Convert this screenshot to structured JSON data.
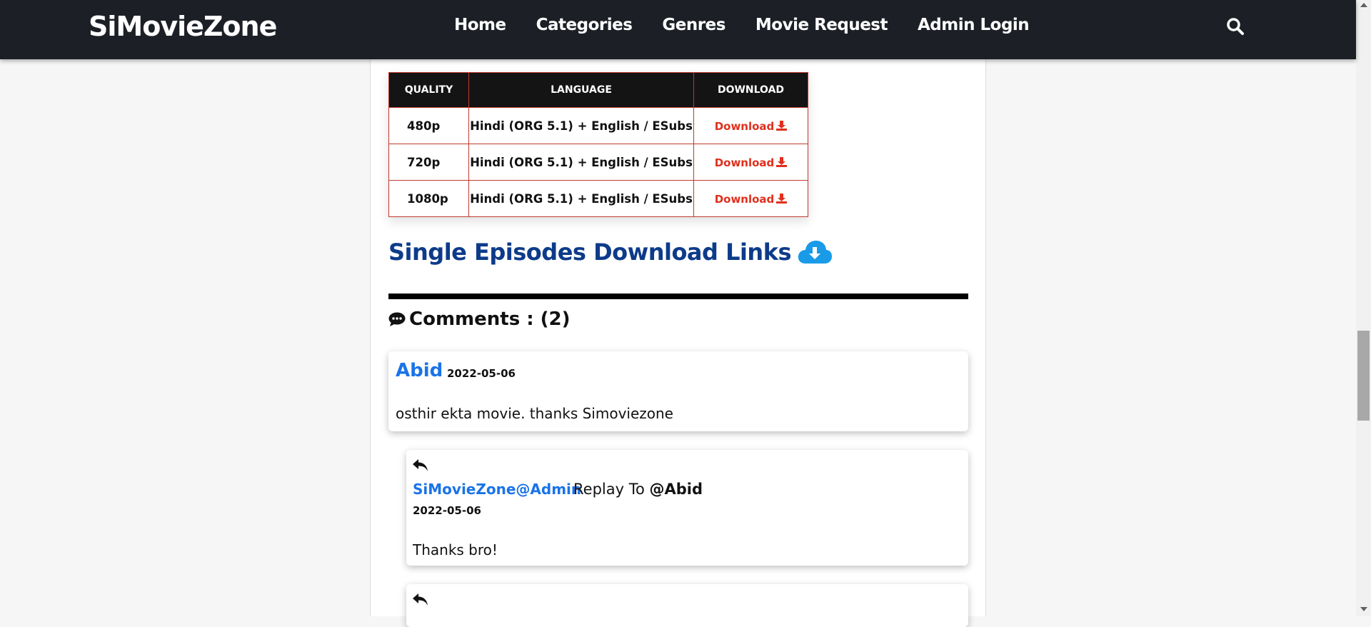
{
  "nav": {
    "brand": "SiMovieZone",
    "links": [
      "Home",
      "Categories",
      "Genres",
      "Movie Request",
      "Admin Login"
    ]
  },
  "downloads": {
    "headers": [
      "QUALITY",
      "LANGUAGE",
      "DOWNLOAD"
    ],
    "rows": [
      {
        "quality": "480p",
        "language": "Hindi (ORG 5.1) + English / ESubs",
        "link": "Download"
      },
      {
        "quality": "720p",
        "language": "Hindi (ORG 5.1) + English / ESubs",
        "link": "Download"
      },
      {
        "quality": "1080p",
        "language": "Hindi (ORG 5.1) + English / ESubs",
        "link": "Download"
      }
    ]
  },
  "episodes_heading": "Single Episodes Download Links",
  "comments": {
    "title": "Comments : (2)",
    "items": [
      {
        "author": "Abid",
        "date": "2022-05-06",
        "text": "osthir ekta movie. thanks Simoviezone",
        "reply": {
          "author": "SiMovieZone@Admin",
          "reply_to_label": "Replay To",
          "reply_to_user": "@Abid",
          "date": "2022-05-06",
          "text": "Thanks bro!"
        }
      }
    ]
  },
  "colors": {
    "nav_bg": "#1c2026",
    "heading_blue": "#0d3b8a",
    "author_blue": "#1a73e8",
    "download_red": "#e0301e",
    "table_border": "#c0392b",
    "cloud_blue": "#1a9be8"
  }
}
